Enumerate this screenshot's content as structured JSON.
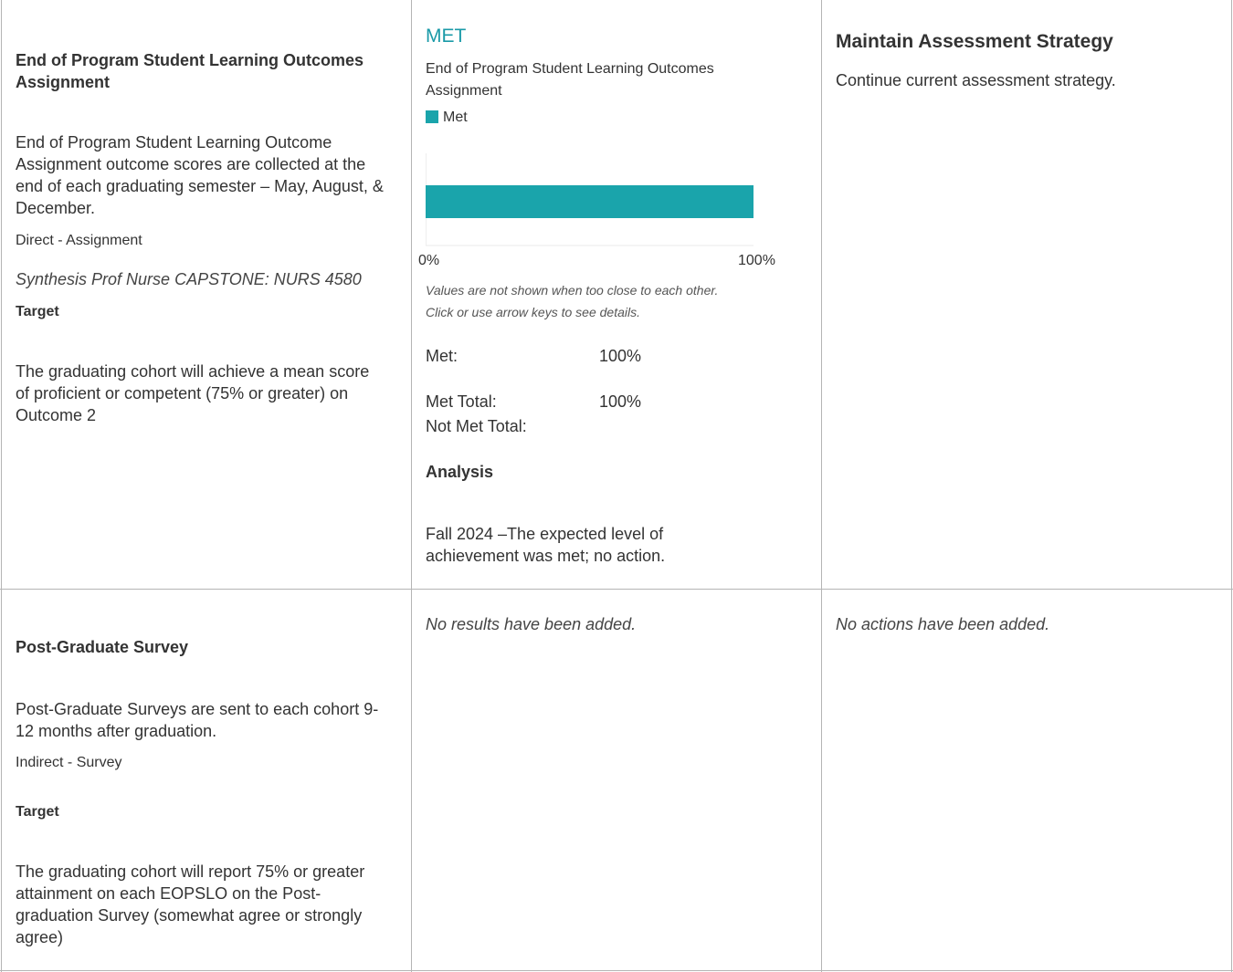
{
  "rows": [
    {
      "method": {
        "title": "End of Program Student Learning Outcomes Assignment",
        "description": "End of Program Student Learning Outcome Assignment outcome scores are collected at the end of each graduating semester – May, August, & December.",
        "type": "Direct - Assignment",
        "course": "Synthesis Prof Nurse CAPSTONE: NURS 4580",
        "target_label": "Target",
        "target_text": "The graduating cohort will achieve a mean score of proficient or competent (75% or greater) on Outcome 2"
      },
      "results": {
        "status": "MET",
        "chart_title": "End of Program Student Learning Outcomes Assignment",
        "legend_label": "Met",
        "axis_min_label": "0%",
        "axis_max_label": "100%",
        "note_line1": "Values are not shown when too close to each other.",
        "note_line2": "Click or use arrow keys to see details.",
        "met_label": "Met:",
        "met_value": "100%",
        "met_total_label": "Met Total:",
        "met_total_value": "100%",
        "not_met_total_label": "Not Met Total:",
        "analysis_label": "Analysis",
        "analysis_text": "Fall 2024 –The expected level of achievement was met; no action."
      },
      "actions": {
        "title": "Maintain Assessment Strategy",
        "text": "Continue current assessment strategy."
      }
    },
    {
      "method": {
        "title": "Post-Graduate Survey",
        "description": "Post-Graduate Surveys are sent to each cohort 9-12 months after graduation.",
        "type": "Indirect - Survey",
        "target_label": "Target",
        "target_text": "The graduating cohort will report 75% or greater attainment on each EOPSLO on the Post-graduation Survey (somewhat agree or strongly agree)"
      },
      "results": {
        "empty_text": "No results have been added."
      },
      "actions": {
        "empty_text": "No actions have been added."
      }
    }
  ],
  "chart_data": {
    "type": "bar",
    "orientation": "horizontal",
    "categories": [
      "End of Program Student Learning Outcomes Assignment"
    ],
    "series": [
      {
        "name": "Met",
        "values": [
          100
        ]
      }
    ],
    "xlim": [
      0,
      100
    ],
    "xticks": [
      "0%",
      "100%"
    ],
    "color": "#1aa4ab"
  },
  "colors": {
    "accent": "#1aa4ab",
    "status_text": "#1a9aa8",
    "border": "#b5b5b5"
  }
}
